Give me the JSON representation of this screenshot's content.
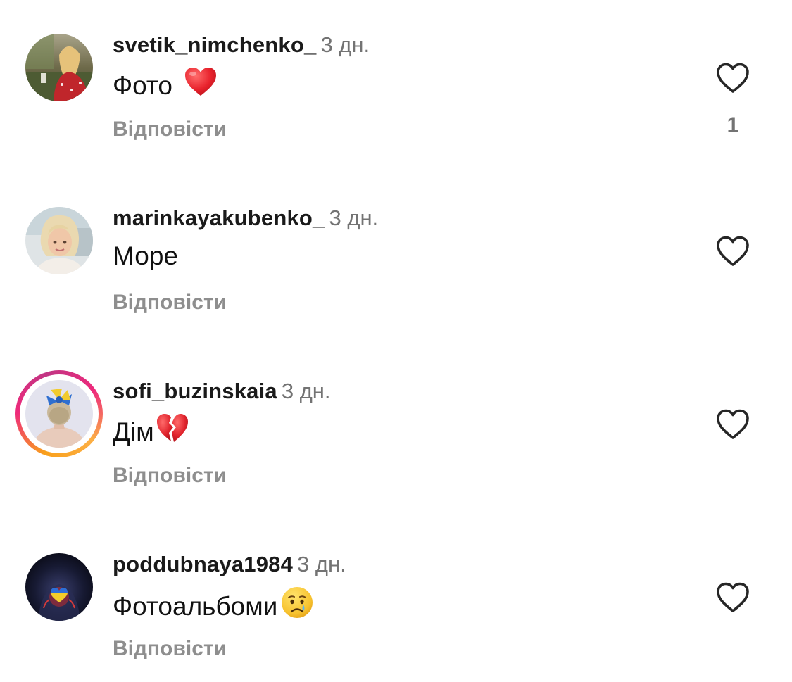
{
  "comments": [
    {
      "username": "svetik_nimchenko_",
      "time": "3 дн.",
      "text": "Фото",
      "emoji": "red-heart",
      "reply_label": "Відповісти",
      "like_count": "1"
    },
    {
      "username": "marinkayakubenko_",
      "time": "3 дн.",
      "text": "Море",
      "reply_label": "Відповісти"
    },
    {
      "username": "sofi_buzinskaia",
      "time": "3 дн.",
      "text": "Дім",
      "emoji": "broken-heart",
      "reply_label": "Відповісти",
      "has_story_ring": true
    },
    {
      "username": "poddubnaya1984",
      "time": "3 дн.",
      "text": "Фотоальбоми",
      "emoji": "crying-face",
      "reply_label": "Відповісти"
    }
  ],
  "icons": {
    "like": "heart-outline-icon"
  },
  "colors": {
    "time_text": "#737373",
    "reply_text": "#8e8e8e",
    "heart_outline": "#262626",
    "story_ring": [
      "#f9a01b",
      "#ee2a7b",
      "#c13584"
    ]
  }
}
